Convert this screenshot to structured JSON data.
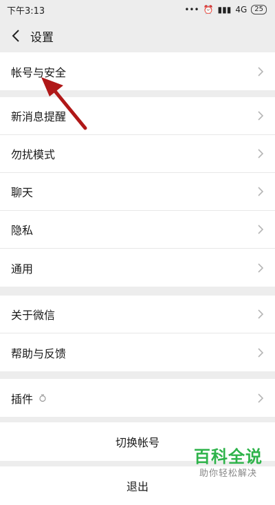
{
  "status_bar": {
    "time": "下午3:13",
    "icons": [
      "dots-icon",
      "alarm-icon",
      "signal-icon"
    ],
    "network": "4G",
    "battery": "25"
  },
  "header": {
    "title": "设置",
    "back_icon": "chevron-left-icon"
  },
  "groups": [
    {
      "items": [
        {
          "label": "帐号与安全"
        }
      ]
    },
    {
      "items": [
        {
          "label": "新消息提醒"
        },
        {
          "label": "勿扰模式"
        },
        {
          "label": "聊天"
        },
        {
          "label": "隐私"
        },
        {
          "label": "通用"
        }
      ]
    },
    {
      "items": [
        {
          "label": "关于微信"
        },
        {
          "label": "帮助与反馈"
        }
      ]
    },
    {
      "items": [
        {
          "label": "插件"
        }
      ]
    }
  ],
  "actions": {
    "switch_account": "切换帐号",
    "logout": "退出"
  },
  "watermark": {
    "title": "百科全说",
    "subtitle": "助你轻松解决"
  },
  "colors": {
    "background": "#ededed",
    "arrow": "#b01818",
    "watermark": "#2eb34a"
  }
}
